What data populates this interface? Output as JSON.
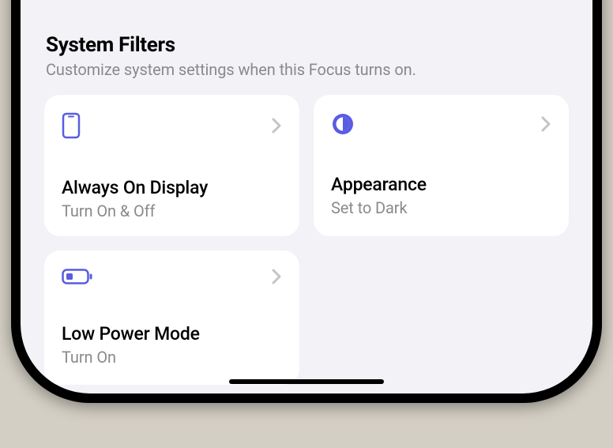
{
  "section": {
    "title": "System Filters",
    "subtitle": "Customize system settings when this Focus turns on."
  },
  "cards": [
    {
      "title": "Always On Display",
      "subtitle": "Turn On & Off"
    },
    {
      "title": "Appearance",
      "subtitle": "Set to Dark"
    },
    {
      "title": "Low Power Mode",
      "subtitle": "Turn On"
    }
  ]
}
